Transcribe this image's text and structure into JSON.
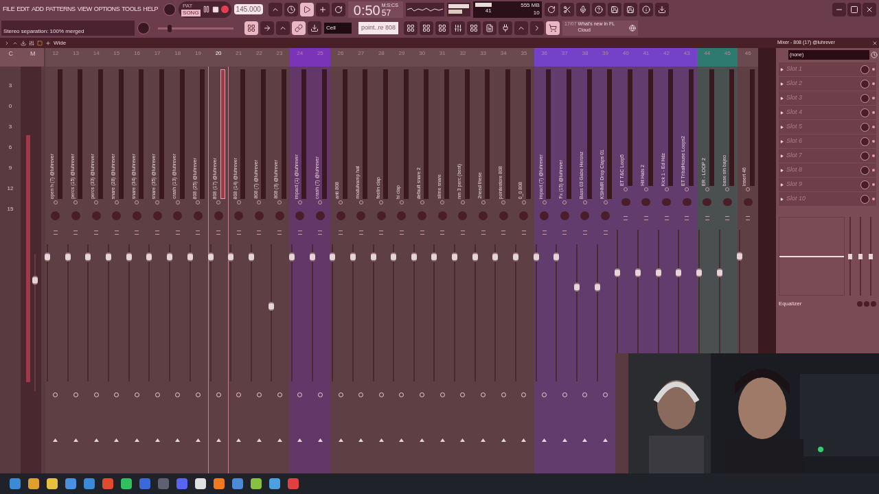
{
  "menu": [
    "FILE",
    "EDIT",
    "ADD",
    "PATTERNS",
    "VIEW",
    "OPTIONS",
    "TOOLS",
    "HELP"
  ],
  "transport": {
    "modes": [
      {
        "label": "PAT",
        "selected": false
      },
      {
        "label": "SONG",
        "selected": true
      }
    ],
    "recording": true,
    "tempo": "145.000",
    "time": "0:50",
    "time_sub": "57",
    "time_unit": "M:S:CS"
  },
  "performance": {
    "cpu": "41",
    "memory": "555 MB",
    "polyphony": "10"
  },
  "hint": "Stereo separation: 100% merged",
  "pitch": {
    "level": 0.13
  },
  "snap": "Cell",
  "pattern": "point..re 808",
  "news": {
    "date": "17/07",
    "text": "What's new in FL Cloud"
  },
  "mixer": {
    "preset": "Wide",
    "master_header": [
      "C",
      "M"
    ],
    "db_scale": [
      "3",
      "0",
      "3",
      "6",
      "9",
      "12",
      "15"
    ],
    "master": {
      "level": 0.8
    },
    "tracks": [
      {
        "number": "12",
        "name": "open h (7) @luhrever",
        "color": "#6a4a4e",
        "selected": false,
        "level": 0.9
      },
      {
        "number": "13",
        "name": "percs (15) @luhrever",
        "color": "#6a4a4e",
        "selected": false,
        "level": 0.9
      },
      {
        "number": "14",
        "name": "percs (33) @luhrever",
        "color": "#6a4a4e",
        "selected": false,
        "level": 0.9
      },
      {
        "number": "15",
        "name": "snare (28) @luhrever",
        "color": "#6a4a4e",
        "selected": false,
        "level": 0.9
      },
      {
        "number": "16",
        "name": "snare (34) @luhrever",
        "color": "#6a4a4e",
        "selected": false,
        "level": 0.9
      },
      {
        "number": "17",
        "name": "snare (35) @luhrever",
        "color": "#6a4a4e",
        "selected": false,
        "level": 0.9
      },
      {
        "number": "18",
        "name": "crash (13) @luhrever",
        "color": "#6a4a4e",
        "selected": false,
        "level": 0.9
      },
      {
        "number": "19",
        "name": "808 (25) @luhrever",
        "color": "#6a4a4e",
        "selected": false,
        "level": 0.9
      },
      {
        "number": "20",
        "name": "808 (17) @luhrever",
        "color": "#6a4a4e",
        "selected": true,
        "level": 0.9
      },
      {
        "number": "21",
        "name": "808 (14) @luhrever",
        "color": "#6a4a4e",
        "selected": false,
        "level": 0.9
      },
      {
        "number": "22",
        "name": "808 (7) @luhrever",
        "color": "#6a4a4e",
        "selected": false,
        "level": 0.9
      },
      {
        "number": "23",
        "name": "808 (3) @luhrever",
        "color": "#6a4a4e",
        "selected": false,
        "level": 0.54
      },
      {
        "number": "24",
        "name": "impact (1) @luhrever",
        "color": "#7a34b8",
        "selected": false,
        "level": 0.9
      },
      {
        "number": "25",
        "name": "crash (7) @luhrever",
        "color": "#7a34b8",
        "selected": false,
        "level": 0.9
      },
      {
        "number": "26",
        "name": "anti 808",
        "color": "#6a4a4e",
        "selected": false,
        "level": 0.9
      },
      {
        "number": "27",
        "name": "modulvamp hat",
        "color": "#6a4a4e",
        "selected": false,
        "level": 0.9
      },
      {
        "number": "28",
        "name": "feelin clap",
        "color": "#6a4a4e",
        "selected": false,
        "level": 0.9
      },
      {
        "number": "29",
        "name": "hi clap",
        "color": "#6a4a4e",
        "selected": false,
        "level": 0.9
      },
      {
        "number": "30",
        "name": "default snare 2",
        "color": "#6a4a4e",
        "selected": false,
        "level": 0.9
      },
      {
        "number": "31",
        "name": "slime snare",
        "color": "#6a4a4e",
        "selected": false,
        "level": 0.9
      },
      {
        "number": "32",
        "name": "nm 3 perc (best)",
        "color": "#6a4a4e",
        "selected": false,
        "level": 0.9
      },
      {
        "number": "33",
        "name": "2need these",
        "color": "#6a4a4e",
        "selected": false,
        "level": 0.9
      },
      {
        "number": "34",
        "name": "pointestore 808",
        "color": "#6a4a4e",
        "selected": false,
        "level": 0.9
      },
      {
        "number": "35",
        "name": "0_0 808",
        "color": "#6a4a4e",
        "selected": false,
        "level": 0.9
      },
      {
        "number": "36",
        "name": "impact (7) @luhrever",
        "color": "#7442c6",
        "selected": false,
        "level": 0.9
      },
      {
        "number": "37",
        "name": "Fx (15) @luhrever",
        "color": "#7442c6",
        "selected": false,
        "level": 0.9
      },
      {
        "number": "38",
        "name": "Bass 03 Gabo Heronz",
        "color": "#7442c6",
        "selected": false,
        "level": 0.68
      },
      {
        "number": "39",
        "name": "KSHMR Drop Claps 01",
        "color": "#7442c6",
        "selected": false,
        "level": 0.68
      },
      {
        "number": "40",
        "name": "ET T&C Loop5",
        "color": "#7442c6",
        "selected": false,
        "level": 0.68
      },
      {
        "number": "41",
        "name": "Hit Hats 2",
        "color": "#7442c6",
        "selected": false,
        "level": 0.68
      },
      {
        "number": "42",
        "name": "Kick 1 - Ed Hdz",
        "color": "#7442c6",
        "selected": false,
        "level": 0.68
      },
      {
        "number": "43",
        "name": "ET TribalHouse Loops2",
        "color": "#7442c6",
        "selected": false,
        "level": 0.68
      },
      {
        "number": "44",
        "name": "ER - LOOP 2",
        "color": "#2f7a70",
        "selected": false,
        "level": 0.68
      },
      {
        "number": "45",
        "name": "base sin bajeo",
        "color": "#2f7a70",
        "selected": false,
        "level": 0.68
      },
      {
        "number": "46",
        "name": "Insert 46",
        "color": "#6a4a4e",
        "selected": false,
        "level": 0.8
      }
    ]
  },
  "channel_panel": {
    "title": "Mixer - 808 (17) @luhrever",
    "preset": "(none)",
    "slots": [
      "Slot 1",
      "Slot 2",
      "Slot 3",
      "Slot 4",
      "Slot 5",
      "Slot 6",
      "Slot 7",
      "Slot 8",
      "Slot 9",
      "Slot 10"
    ],
    "eq_label": "Equalizer",
    "eq_bands": [
      {
        "level": 0.5
      },
      {
        "level": 0.5
      },
      {
        "level": 0.5
      }
    ]
  }
}
